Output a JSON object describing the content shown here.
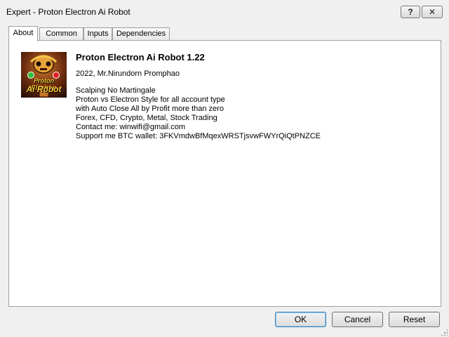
{
  "window": {
    "title": "Expert - Proton Electron Ai Robot",
    "help_label": "?",
    "close_label": "✕"
  },
  "tabs": [
    {
      "label": "About",
      "active": true
    },
    {
      "label": "Common",
      "active": false
    },
    {
      "label": "Inputs",
      "active": false
    },
    {
      "label": "Dependencies",
      "active": false
    }
  ],
  "about": {
    "logo": {
      "line1": "Proton Electron",
      "line2": "Ai Robot"
    },
    "heading": "Proton Electron Ai Robot 1.22",
    "author": "2022, Mr.Nirundorn Promphao",
    "description": [
      "Scalping No Martingale",
      "Proton vs Electron Style for all account type",
      "with Auto Close All by Profit more than zero",
      "Forex, CFD, Crypto, Metal, Stock Trading",
      "Contact me: winwifi@gmail.com",
      "Support me BTC wallet: 3FKVmdwBfMqexWRSTjsvwFWYrQiQtPNZCE"
    ]
  },
  "buttons": {
    "ok": "OK",
    "cancel": "Cancel",
    "reset": "Reset"
  }
}
